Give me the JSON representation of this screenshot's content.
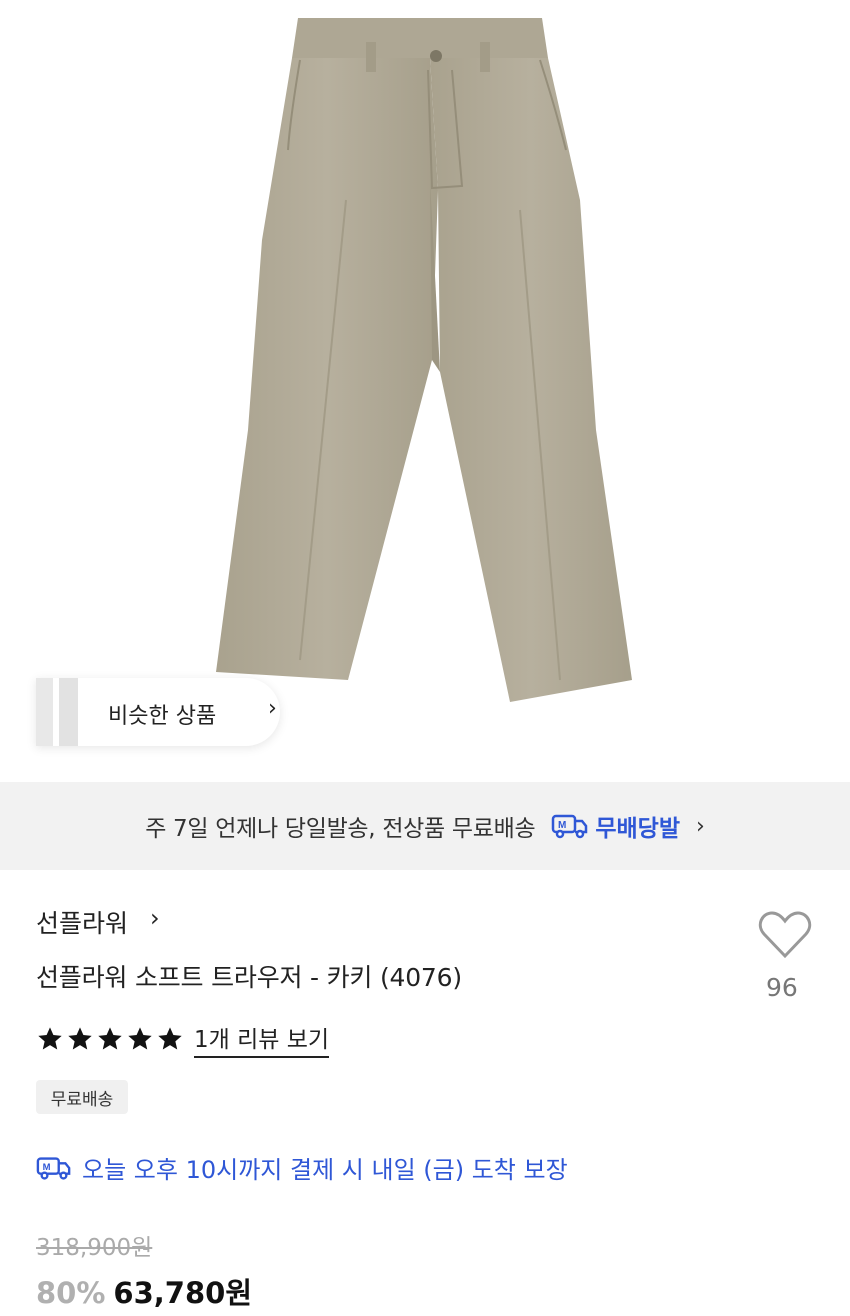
{
  "product_image": {
    "alt": "khaki trousers",
    "colors": {
      "fabric": "#b4ad9b",
      "fabric_shadow": "#9f9884",
      "background": "#ffffff"
    }
  },
  "similar_button": {
    "label": "비슷한 상품",
    "chevron": "chevron-right-icon"
  },
  "shipping_banner": {
    "text": "주 7일 언제나 당일발송, 전상품 무료배송",
    "logo_text": "무배당발",
    "logo_icon": "delivery-truck-icon",
    "accent": "#2f57d6"
  },
  "product": {
    "brand": "선플라워",
    "title": "선플라워 소프트 트라우저 - 카키 (4076)",
    "likes": "96",
    "rating_stars": 5,
    "review_link": "1개 리뷰 보기",
    "badge": "무료배송",
    "arrival_notice": "오늘 오후 10시까지 결제 시 내일 (금) 도착 보장",
    "original_price": "318,900원",
    "discount": "80%",
    "final_price": "63,780원"
  }
}
